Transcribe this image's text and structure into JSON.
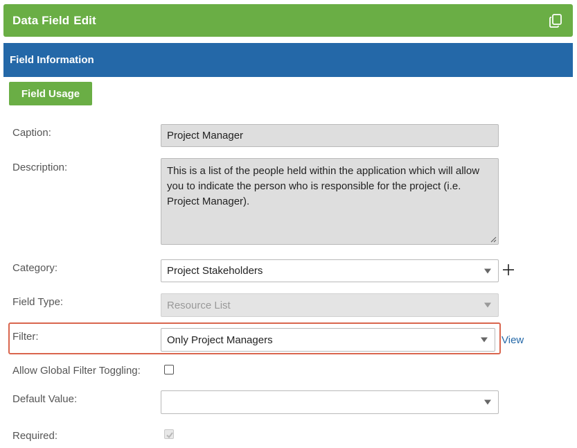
{
  "header": {
    "word1": "Data Field",
    "word2": "Edit",
    "copy_icon": "copy-icon"
  },
  "section": {
    "title": "Field Information"
  },
  "buttons": {
    "field_usage": "Field Usage"
  },
  "fields": {
    "caption": {
      "label": "Caption:",
      "value": "Project Manager"
    },
    "description": {
      "label": "Description:",
      "value": "This is a list of the people held within the application which will allow you to indicate the person who is responsible for the project (i.e. Project Manager)."
    },
    "category": {
      "label": "Category:",
      "value": "Project Stakeholders",
      "add_icon": "plus-icon"
    },
    "field_type": {
      "label": "Field Type:",
      "value": "Resource List",
      "disabled": true
    },
    "filter": {
      "label": "Filter:",
      "value": "Only Project Managers",
      "view_link": "View"
    },
    "allow_global_filter_toggling": {
      "label": "Allow Global Filter Toggling:",
      "checked": false
    },
    "default_value": {
      "label": "Default Value:",
      "value": ""
    },
    "required": {
      "label": "Required:",
      "checked": true,
      "disabled": true
    }
  },
  "colors": {
    "green": "#6aae45",
    "blue": "#2468a8",
    "highlight": "#d9654d"
  }
}
